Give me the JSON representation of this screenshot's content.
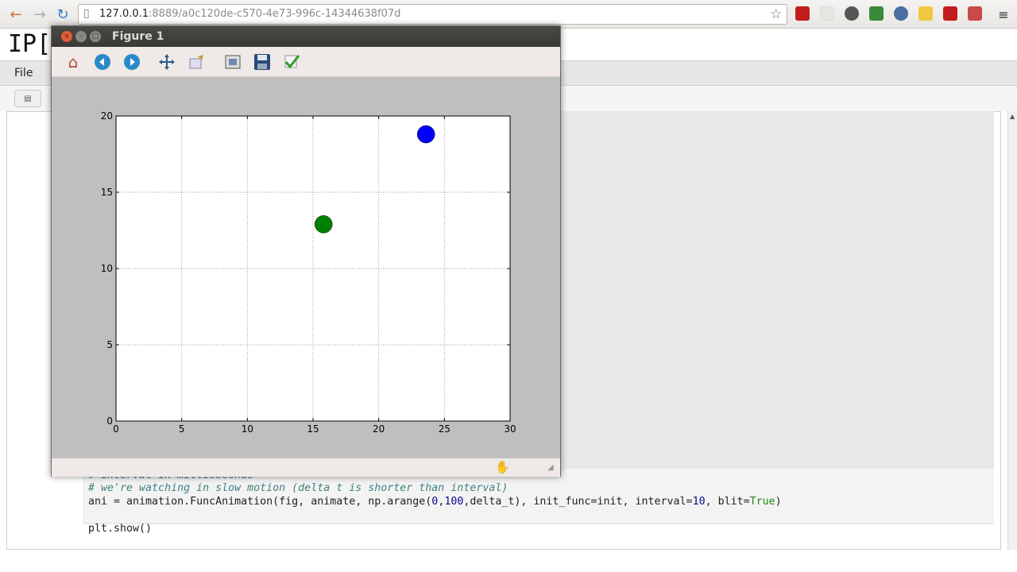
{
  "browser": {
    "url_host": "127.0.0.1",
    "url_rest": ":8889/a0c120de-c570-4e73-996c-14344638f07d"
  },
  "page": {
    "logo_text": "IP[y",
    "menu_file": "File",
    "toolbar_btn": "▤"
  },
  "code": {
    "line_comment1": "# interval in milliseconds",
    "line_comment2": "# we're watching in slow motion (delta t is shorter than interval)",
    "ani_prefix": "ani = animation.FuncAnimation(fig, animate, np.arange(",
    "ani_n0": "0",
    "ani_comma": ",",
    "ani_n100": "100",
    "ani_mid": ",delta_t), init_func=init, interval=",
    "ani_n10": "10",
    "ani_blit": ", blit=",
    "ani_true": "True",
    "ani_close": ")",
    "line_show": "plt.show()"
  },
  "figure": {
    "window_title": "Figure 1",
    "tools": [
      "home-icon",
      "back-icon",
      "forward-icon",
      "pan-icon",
      "zoom-icon",
      "subplots-icon",
      "save-icon",
      "edit-icon"
    ],
    "cursor_icon": "hand-cursor-icon"
  },
  "chart_data": {
    "type": "scatter",
    "title": "",
    "xlabel": "",
    "ylabel": "",
    "xlim": [
      0,
      30
    ],
    "ylim": [
      0,
      20
    ],
    "xticks": [
      0,
      5,
      10,
      15,
      20,
      25,
      30
    ],
    "yticks": [
      0,
      5,
      10,
      15,
      20
    ],
    "grid": true,
    "series": [
      {
        "color": "#0000ff",
        "points": [
          [
            23.6,
            18.8
          ]
        ]
      },
      {
        "color": "#008000",
        "points": [
          [
            15.8,
            12.9
          ]
        ]
      }
    ]
  },
  "colors": {
    "accent_red": "#cc2020",
    "code_comment": "#408080",
    "code_number": "#0a0a8a",
    "code_keyword": "#1a8a1a"
  }
}
